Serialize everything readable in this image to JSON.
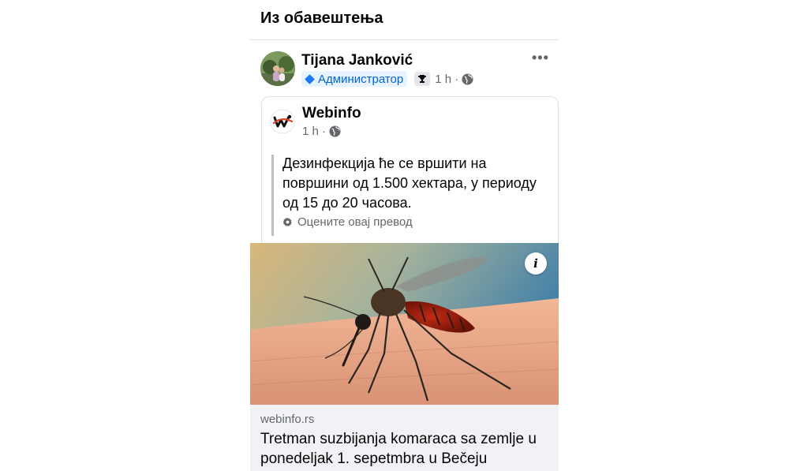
{
  "section": {
    "title": "Из обавештења"
  },
  "post": {
    "author": "Tijana Janković",
    "badge_label": "Администратор",
    "time": "1 h ·",
    "more_label": "•••"
  },
  "shared": {
    "page_name": "Webinfo",
    "time": "1 h ·",
    "text": "Дезинфекција ће се вршити на површини од 1.500 хектара, у периоду од 15 до 20 часова.",
    "rate_translation": "Оцените овај превод"
  },
  "media": {
    "info_label": "i"
  },
  "link": {
    "domain": "webinfo.rs",
    "title": "Tretman suzbijanja komaraca sa zemlje u ponedeljak 1. sepetmbra u Bečeju"
  },
  "colors": {
    "accent": "#1877f2",
    "badge_bg": "#e7f3ff",
    "footer_bg": "#f0f2f5",
    "meta": "#65676b"
  }
}
